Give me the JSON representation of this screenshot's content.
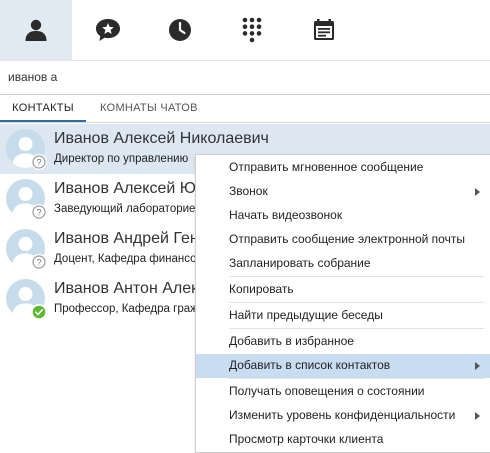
{
  "topbar": {
    "icons": [
      "contacts-icon",
      "chat-star-icon",
      "clock-icon",
      "dialpad-icon",
      "calendar-icon"
    ]
  },
  "search": {
    "value": "иванов а"
  },
  "tabs": [
    {
      "label": "КОНТАКТЫ"
    },
    {
      "label": "КОМНАТЫ ЧАТОВ"
    }
  ],
  "contacts": [
    {
      "name": "Иванов Алексей Николаевич",
      "title": "Директор по управлению",
      "status": "unknown"
    },
    {
      "name": "Иванов Алексей Юр",
      "title": "Заведующий лабораторие",
      "status": "unknown"
    },
    {
      "name": "Иванов Андрей Генн",
      "title": "Доцент, Кафедра финансо",
      "status": "unknown"
    },
    {
      "name": "Иванов Антон Алекс",
      "title": "Профессор, Кафедра граж",
      "status": "available"
    }
  ],
  "menu": {
    "items": [
      {
        "label": "Отправить мгновенное сообщение"
      },
      {
        "label": "Звонок"
      },
      {
        "label": "Начать видеозвонок"
      },
      {
        "label": "Отправить сообщение электронной почты"
      },
      {
        "label": "Запланировать собрание"
      },
      {
        "label": "Копировать"
      },
      {
        "label": "Найти предыдущие беседы"
      },
      {
        "label": "Добавить в избранное"
      },
      {
        "label": "Добавить в список контактов"
      },
      {
        "label": "Получать оповещения о состоянии"
      },
      {
        "label": "Изменить уровень конфиденциальности"
      },
      {
        "label": "Просмотр карточки клиента"
      }
    ]
  },
  "colors": {
    "accent": "#2d6ca2",
    "selected_row": "#dde7f1",
    "menu_highlight": "#c8ddf2",
    "presence_available": "#5cb833",
    "avatar_bg": "#c7dcea"
  }
}
